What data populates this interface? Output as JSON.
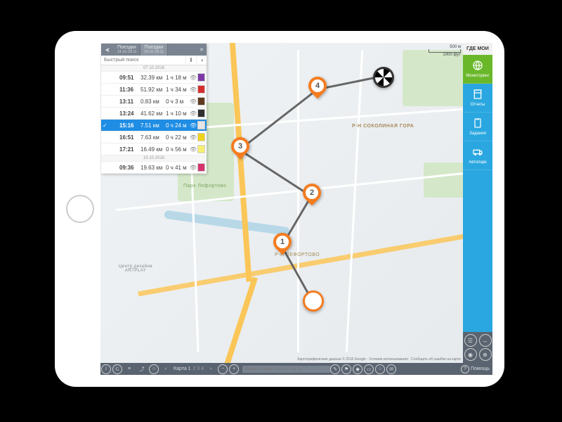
{
  "tabs": [
    {
      "title": "Поездки",
      "range": "14.10–29.11"
    },
    {
      "title": "Поездки",
      "range": "03.10–29.11"
    }
  ],
  "search_placeholder": "Быстрый поиск",
  "groups": [
    {
      "date": "07.10.2016",
      "trips": [
        {
          "time": "09:51",
          "dist": "32.39 км",
          "dur": "1 ч 18 м",
          "color": "#7b3aa5",
          "sel": false
        },
        {
          "time": "11:36",
          "dist": "51.92 км",
          "dur": "1 ч 34 м",
          "color": "#d62f2f",
          "sel": false
        },
        {
          "time": "13:11",
          "dist": "0.83 км",
          "dur": "0 ч 3 м",
          "color": "#5f3a1f",
          "sel": false
        },
        {
          "time": "13:24",
          "dist": "41.62 км",
          "dur": "1 ч 10 м",
          "color": "#2f2f2f",
          "sel": false
        },
        {
          "time": "15:16",
          "dist": "7.51 км",
          "dur": "0 ч 24 м",
          "color": "#e6e6e6",
          "sel": true
        },
        {
          "time": "16:51",
          "dist": "7.63 км",
          "dur": "0 ч 22 м",
          "color": "#f0d21a",
          "sel": false
        },
        {
          "time": "17:21",
          "dist": "16.49 км",
          "dur": "0 ч 56 м",
          "color": "#f6ee70",
          "sel": false
        }
      ]
    },
    {
      "date": "10.10.2016",
      "trips": [
        {
          "time": "09:36",
          "dist": "19.63 км",
          "dur": "0 ч 41 м",
          "color": "#d6336c",
          "sel": false
        }
      ]
    }
  ],
  "brand": "ГДЕ МОИ",
  "right_nav": [
    {
      "id": "monitoring",
      "label": "Мониторинг",
      "active": true
    },
    {
      "id": "reports",
      "label": "Отчеты",
      "active": false
    },
    {
      "id": "tasks",
      "label": "Задания",
      "active": false
    },
    {
      "id": "fleet",
      "label": "Автопарк",
      "active": false
    }
  ],
  "scale_labels": [
    "500 м",
    "1000 фут"
  ],
  "map_tab": "Карта 1",
  "address_placeholder": "Введите адрес или его часть",
  "help": "Помощь",
  "districts": {
    "sokolinaya": "Р-Н СОКОЛИНАЯ ГОРА",
    "lefortovo": "Р-Н ЛЕФОРТОВО"
  },
  "park_labels": {
    "lefortovo": "Парк Лефортово"
  },
  "credit": "Картографические данные © 2016 Google · Условия использования · Сообщить об ошибке на карте",
  "waypoints": [
    "1",
    "2",
    "3",
    "4"
  ],
  "poi": {
    "artplay": "Центр дизайна ARTPLAY"
  }
}
